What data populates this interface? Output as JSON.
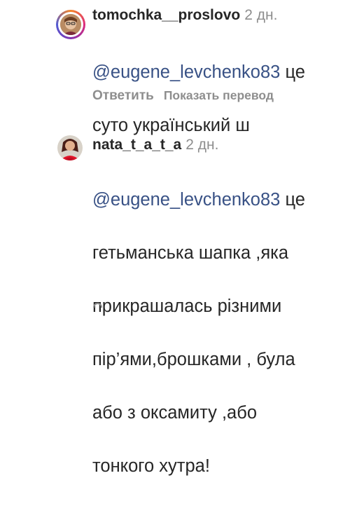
{
  "comments": [
    {
      "username": "tomochka__proslovo",
      "time": "2 дн.",
      "mention": "@eugene_levchenko83",
      "text_line1": " це",
      "text_line2": "суто український ш",
      "reply_label": "Ответить",
      "translate_label": "Показать перевод"
    },
    {
      "username": "nata_t_a_t_a",
      "time": "2 дн.",
      "mention": "@eugene_levchenko83",
      "text_line1": " це",
      "text_line2": "гетьманська шапка ,яка",
      "text_line3": "прикрашалась різними",
      "text_line4": "пір’ями,брошками , була",
      "text_line5": "або з оксамиту ,або",
      "text_line6": "тонкого хутра!"
    }
  ]
}
